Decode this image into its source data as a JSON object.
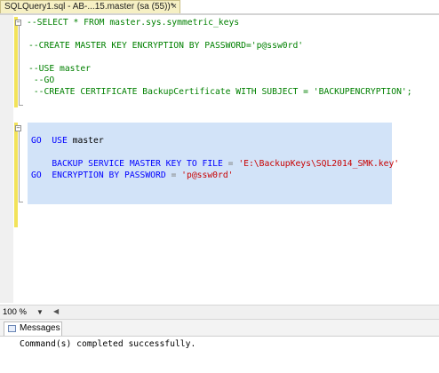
{
  "tab": {
    "title": "SQLQuery1.sql - AB-...15.master (sa (55))*",
    "close_glyph": "×"
  },
  "editor": {
    "fold_glyph": "−",
    "lines": {
      "l1": "--SELECT * FROM master.sys.symmetric_keys",
      "l3": "--CREATE MASTER KEY ENCRYPTION BY PASSWORD='p@ssw0rd'",
      "l5": "--USE master",
      "l6": " --GO",
      "l7": " --CREATE CERTIFICATE BackupCertificate WITH SUBJECT = 'BACKUPENCRYPTION';",
      "l10_kw": "USE",
      "l10_rest": " master",
      "l11": "GO",
      "l12_kw": "BACKUP SERVICE MASTER KEY TO FILE",
      "l12_op": " = ",
      "l12_str": "'E:\\BackupKeys\\SQL2014_SMK.key'",
      "l13_kw": "ENCRYPTION BY PASSWORD",
      "l13_op": " = ",
      "l13_str": "'p@ssw0rd'",
      "l14": "GO"
    }
  },
  "statusbar": {
    "zoom": "100 %",
    "zoom_caret": "▼",
    "scroll_left": "◀"
  },
  "results": {
    "tab_label": "Messages",
    "message": "Command(s) completed successfully."
  }
}
